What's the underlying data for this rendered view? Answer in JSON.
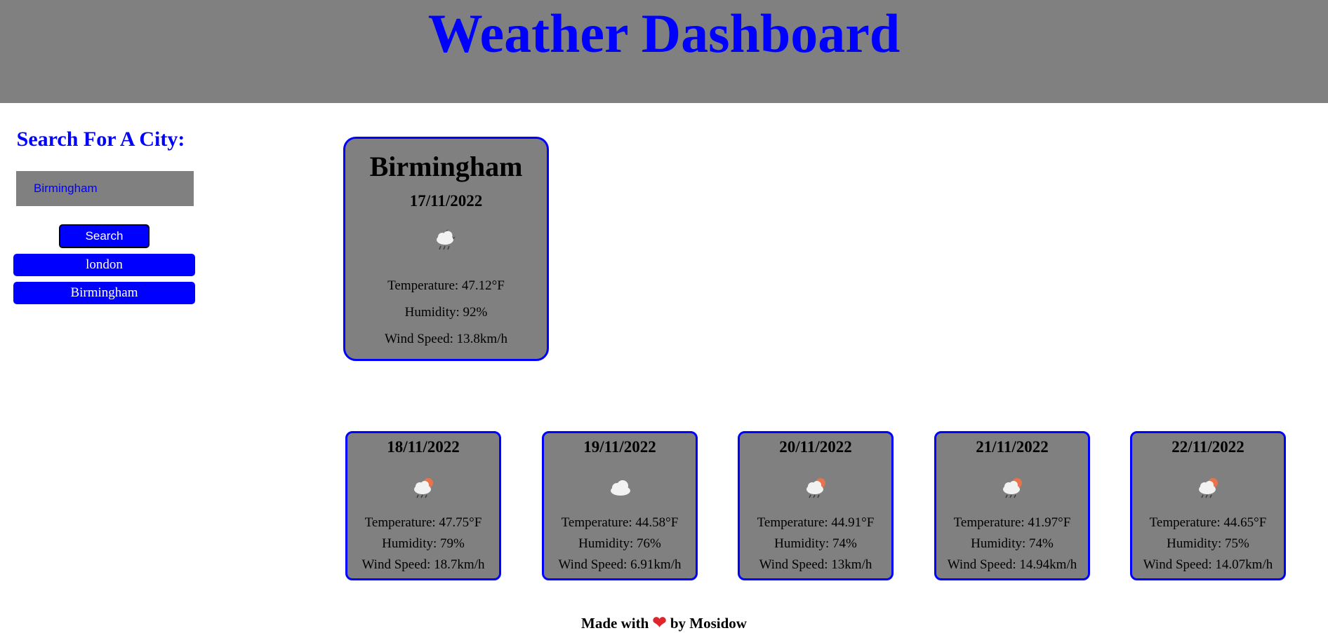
{
  "header": {
    "title": "Weather Dashboard"
  },
  "sidebar": {
    "heading": "Search For A City:",
    "search_value": "Birmingham",
    "search_button": "Search",
    "history": [
      "london",
      "Birmingham"
    ]
  },
  "current": {
    "city": "Birmingham",
    "date": "17/11/2022",
    "icon": "cloud-moon-rain-icon",
    "temperature": "Temperature: 47.12°F",
    "humidity": "Humidity: 92%",
    "wind": "Wind Speed: 13.8km/h"
  },
  "forecast": [
    {
      "date": "18/11/2022",
      "icon": "cloud-sun-rain-icon",
      "temperature": "Temperature: 47.75°F",
      "humidity": "Humidity: 79%",
      "wind": "Wind Speed: 18.7km/h"
    },
    {
      "date": "19/11/2022",
      "icon": "cloud-icon",
      "temperature": "Temperature: 44.58°F",
      "humidity": "Humidity: 76%",
      "wind": "Wind Speed: 6.91km/h"
    },
    {
      "date": "20/11/2022",
      "icon": "cloud-sun-rain-icon",
      "temperature": "Temperature: 44.91°F",
      "humidity": "Humidity: 74%",
      "wind": "Wind Speed: 13km/h"
    },
    {
      "date": "21/11/2022",
      "icon": "cloud-sun-rain-icon",
      "temperature": "Temperature: 41.97°F",
      "humidity": "Humidity: 74%",
      "wind": "Wind Speed: 14.94km/h"
    },
    {
      "date": "22/11/2022",
      "icon": "cloud-sun-rain-icon",
      "temperature": "Temperature: 44.65°F",
      "humidity": "Humidity: 75%",
      "wind": "Wind Speed: 14.07km/h"
    }
  ],
  "footer": {
    "before": "Made with",
    "heart_icon": "heart-icon",
    "after": "by Mosidow"
  },
  "colors": {
    "accent": "#0000ff",
    "panel": "#808080",
    "heart": "#e0262d"
  }
}
